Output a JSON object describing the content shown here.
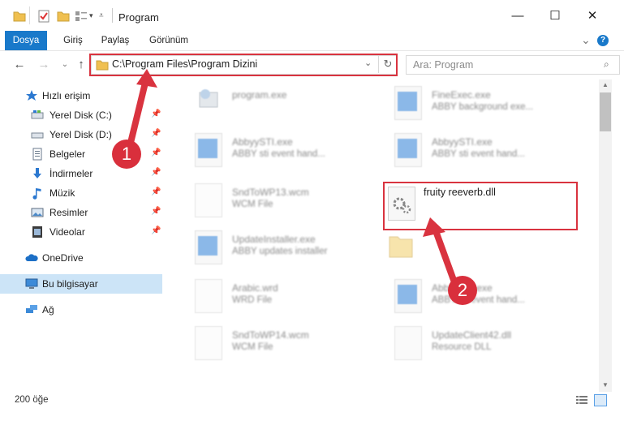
{
  "window": {
    "title": "Program",
    "minimize": "—",
    "maximize": "☐",
    "close": "✕"
  },
  "ribbon": {
    "tabs": [
      "Dosya",
      "Giriş",
      "Paylaş",
      "Görünüm"
    ],
    "collapse": "⌄",
    "help": "?"
  },
  "address": {
    "path": "C:\\Program Files\\Program Dizini",
    "search_placeholder": "Ara: Program"
  },
  "sidebar": {
    "items": [
      {
        "label": "Hızlı erişim",
        "icon": "star-icon",
        "pinned": false
      },
      {
        "label": "Yerel Disk (C:)",
        "icon": "drive-icon",
        "pinned": true
      },
      {
        "label": "Yerel Disk (D:)",
        "icon": "drive-icon",
        "pinned": true
      },
      {
        "label": "Belgeler",
        "icon": "documents-icon",
        "pinned": true
      },
      {
        "label": "İndirmeler",
        "icon": "download-icon",
        "pinned": true
      },
      {
        "label": "Müzik",
        "icon": "music-icon",
        "pinned": true
      },
      {
        "label": "Resimler",
        "icon": "pictures-icon",
        "pinned": true
      },
      {
        "label": "Videolar",
        "icon": "video-icon",
        "pinned": true
      },
      {
        "label": "OneDrive",
        "icon": "cloud-icon",
        "pinned": false
      },
      {
        "label": "Bu bilgisayar",
        "icon": "computer-icon",
        "pinned": false
      },
      {
        "label": "Ağ",
        "icon": "network-icon",
        "pinned": false
      }
    ]
  },
  "files": [
    {
      "name": "program.exe",
      "desc": "",
      "icon": "exe-icon"
    },
    {
      "name": "FineExec.exe",
      "desc": "ABBY background exe...",
      "icon": "exe-icon"
    },
    {
      "name": "AbbyySTI.exe",
      "desc": "ABBY sti event hand...",
      "icon": "exe-icon"
    },
    {
      "name": "AbbyySTI.exe",
      "desc": "ABBY sti event hand...",
      "icon": "exe-icon"
    },
    {
      "name": "SndToWP13.wcm",
      "desc": "WCM File",
      "icon": "document-icon"
    },
    {
      "name": "fruity reeverb.dll",
      "desc": "",
      "icon": "dll-gear-icon"
    },
    {
      "name": "UpdateInstaller.exe",
      "desc": "ABBY updates installer",
      "icon": "exe-icon"
    },
    {
      "name": "",
      "desc": "",
      "icon": "folder-icon"
    },
    {
      "name": "Arabic.wrd",
      "desc": "WRD File",
      "icon": "document-icon"
    },
    {
      "name": "AbbyySTI.exe",
      "desc": "ABBY sti event hand...",
      "icon": "exe-icon"
    },
    {
      "name": "SndToWP14.wcm",
      "desc": "WCM File",
      "icon": "document-icon"
    },
    {
      "name": "UpdateClient42.dll",
      "desc": "Resource DLL",
      "icon": "dll-gear-icon"
    }
  ],
  "status": {
    "item_count": "200 öğe"
  },
  "annotations": {
    "step1": "1",
    "step2": "2",
    "color": "#d9333f"
  }
}
